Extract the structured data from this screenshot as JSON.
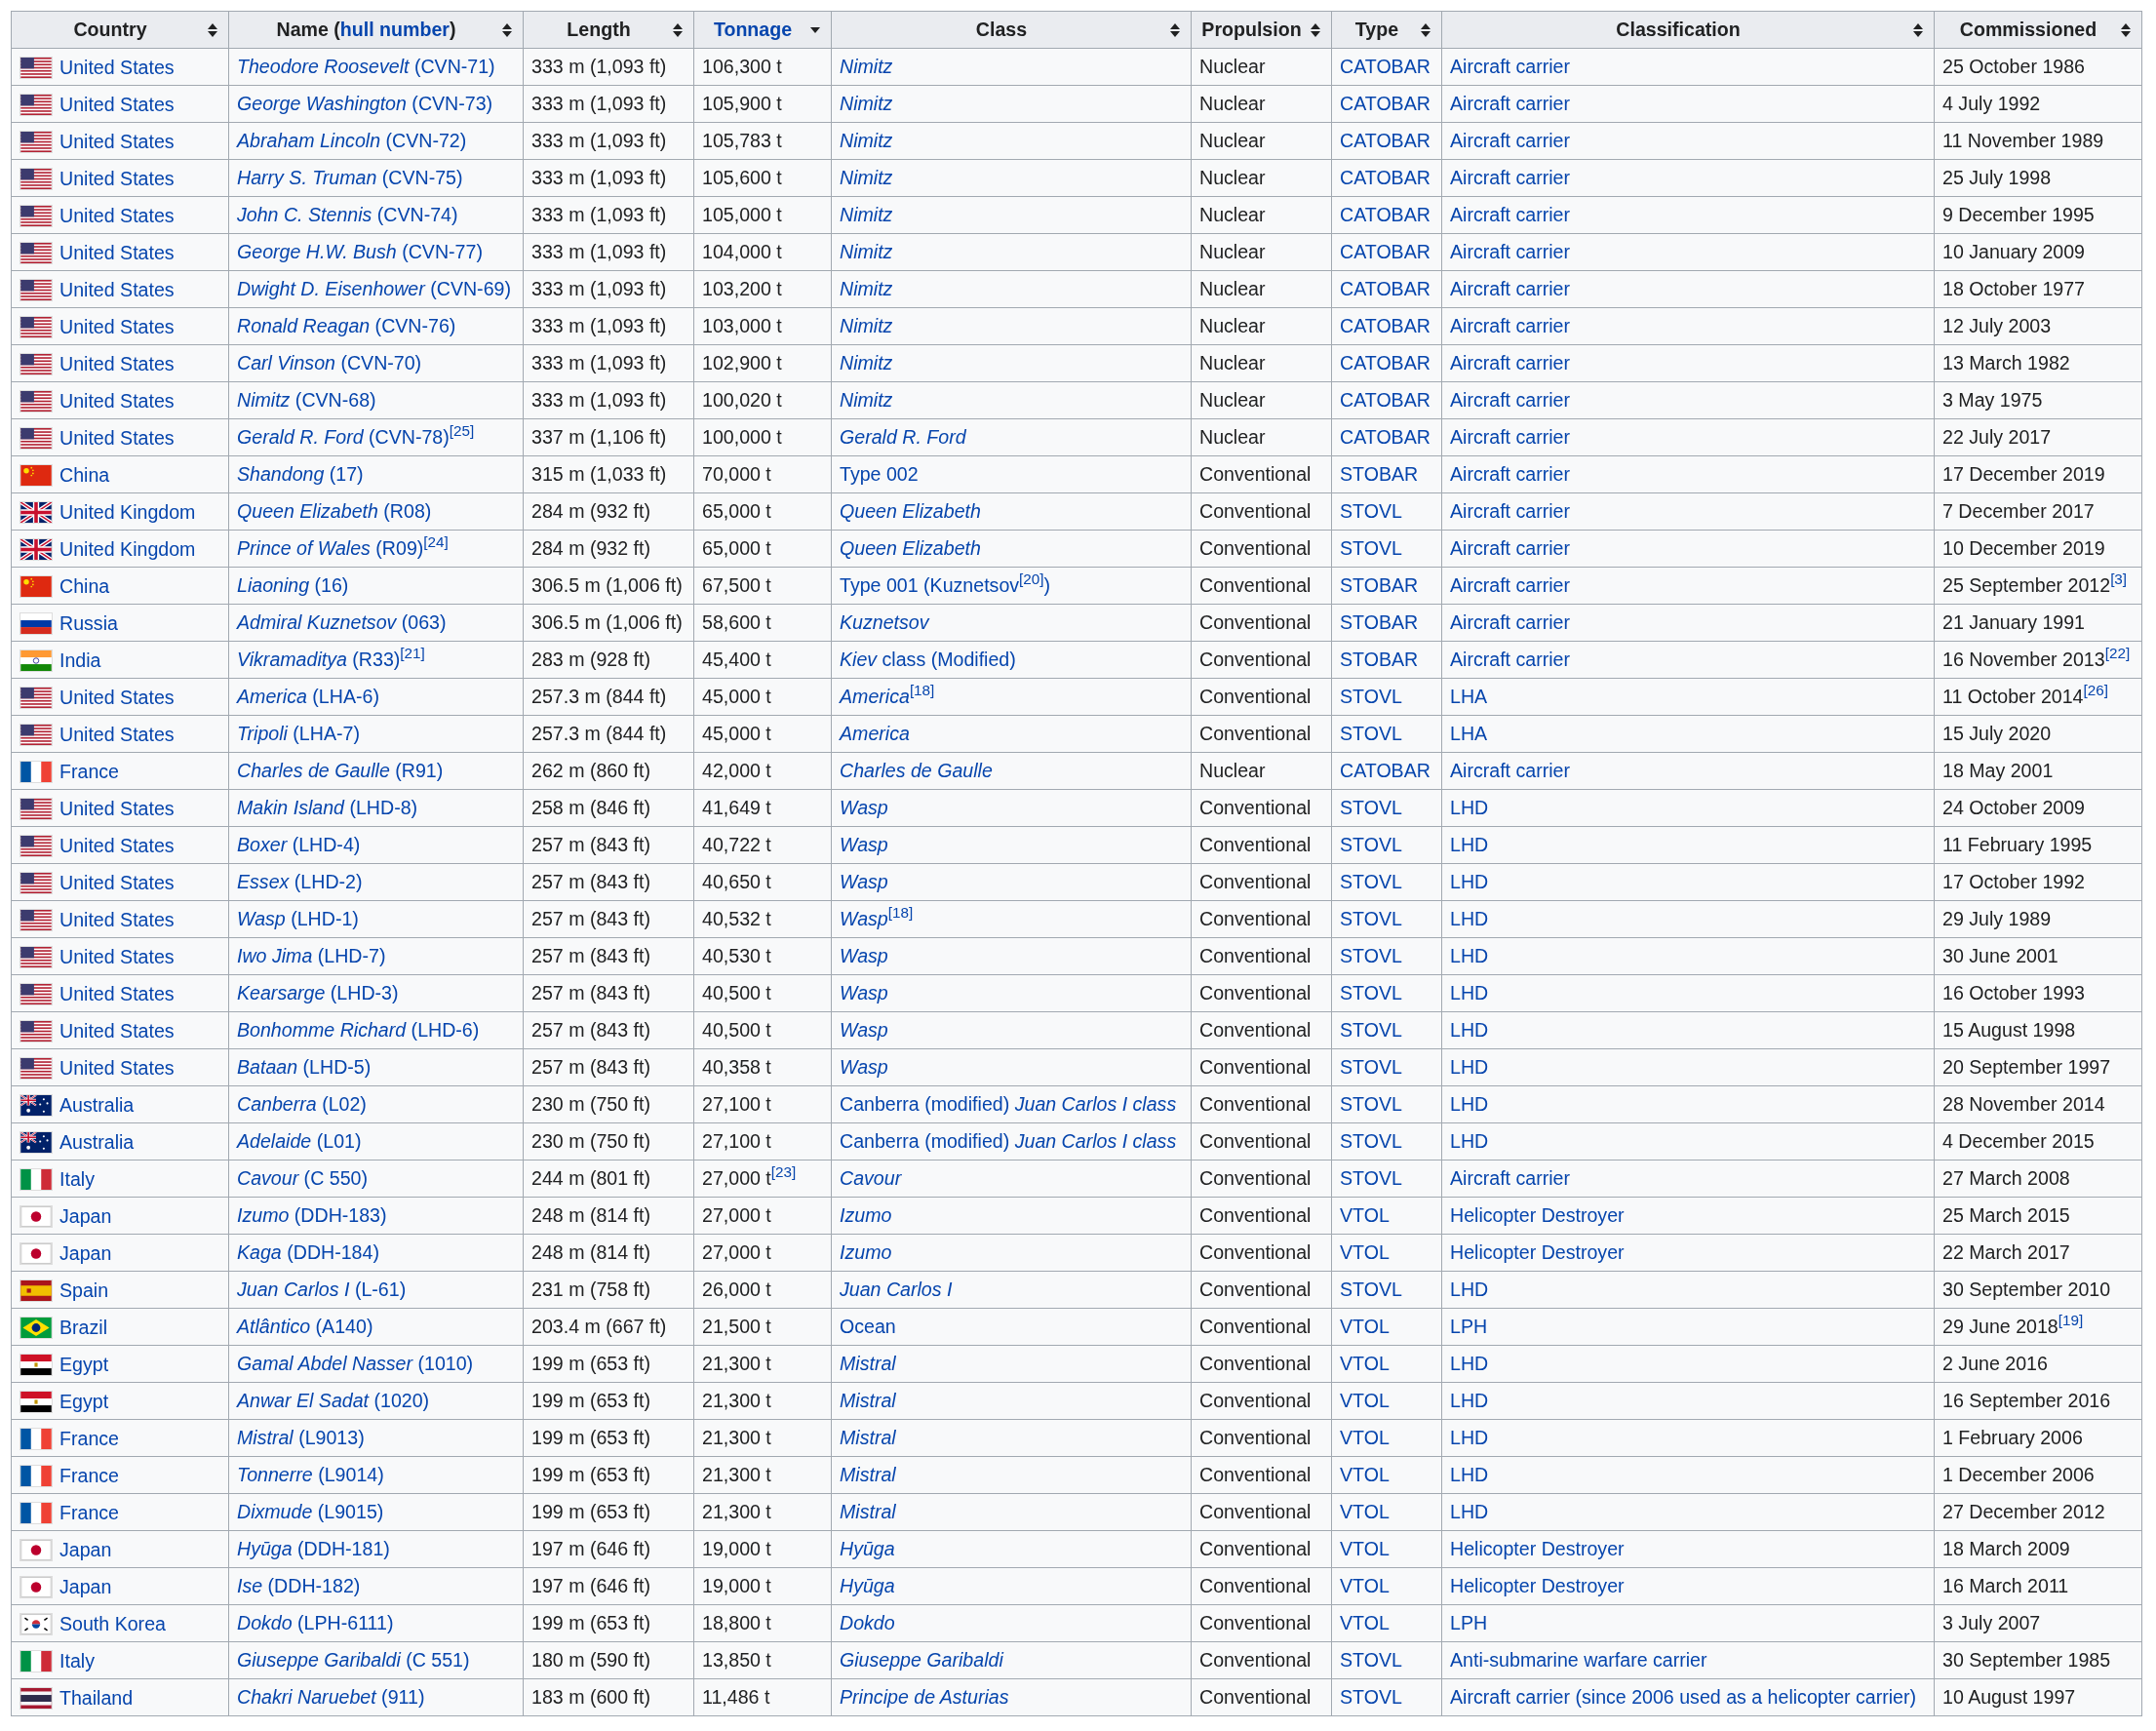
{
  "table": {
    "columns": [
      {
        "parts": [
          {
            "text": "Country",
            "link": false
          }
        ],
        "sorted": false
      },
      {
        "parts": [
          {
            "text": "Name (",
            "link": false
          },
          {
            "text": "hull number",
            "link": true
          },
          {
            "text": ")",
            "link": false
          }
        ],
        "sorted": false
      },
      {
        "parts": [
          {
            "text": "Length",
            "link": false
          }
        ],
        "sorted": false
      },
      {
        "parts": [
          {
            "text": "Tonnage",
            "link": true
          }
        ],
        "sorted": true
      },
      {
        "parts": [
          {
            "text": "Class",
            "link": false
          }
        ],
        "sorted": false
      },
      {
        "parts": [
          {
            "text": "Propulsion",
            "link": false
          }
        ],
        "sorted": false
      },
      {
        "parts": [
          {
            "text": "Type",
            "link": false
          }
        ],
        "sorted": false
      },
      {
        "parts": [
          {
            "text": "Classification",
            "link": false
          }
        ],
        "sorted": false
      },
      {
        "parts": [
          {
            "text": "Commissioned",
            "link": false
          }
        ],
        "sorted": false
      }
    ],
    "rows": [
      {
        "kind": "us",
        "country": "United States",
        "name": "*Theodore Roosevelt* (CVN-71)",
        "length": "333 m (1,093 ft)",
        "tonnage": "106,300 t",
        "class": "*Nimitz*",
        "propulsion": "Nuclear",
        "type": "CATOBAR",
        "classification": "Aircraft carrier",
        "commissioned": "25 October 1986"
      },
      {
        "kind": "us",
        "country": "United States",
        "name": "*George Washington* (CVN-73)",
        "length": "333 m (1,093 ft)",
        "tonnage": "105,900 t",
        "class": "*Nimitz*",
        "propulsion": "Nuclear",
        "type": "CATOBAR",
        "classification": "Aircraft carrier",
        "commissioned": "4 July 1992"
      },
      {
        "kind": "us",
        "country": "United States",
        "name": "*Abraham Lincoln* (CVN-72)",
        "length": "333 m (1,093 ft)",
        "tonnage": "105,783 t",
        "class": "*Nimitz*",
        "propulsion": "Nuclear",
        "type": "CATOBAR",
        "classification": "Aircraft carrier",
        "commissioned": "11 November 1989"
      },
      {
        "kind": "us",
        "country": "United States",
        "name": "*Harry S. Truman* (CVN-75)",
        "length": "333 m (1,093 ft)",
        "tonnage": "105,600 t",
        "class": "*Nimitz*",
        "propulsion": "Nuclear",
        "type": "CATOBAR",
        "classification": "Aircraft carrier",
        "commissioned": "25 July 1998"
      },
      {
        "kind": "us",
        "country": "United States",
        "name": "*John C. Stennis* (CVN-74)",
        "length": "333 m (1,093 ft)",
        "tonnage": "105,000 t",
        "class": "*Nimitz*",
        "propulsion": "Nuclear",
        "type": "CATOBAR",
        "classification": "Aircraft carrier",
        "commissioned": "9 December 1995"
      },
      {
        "kind": "us",
        "country": "United States",
        "name": "*George H.W. Bush* (CVN-77)",
        "length": "333 m (1,093 ft)",
        "tonnage": "104,000 t",
        "class": "*Nimitz*",
        "propulsion": "Nuclear",
        "type": "CATOBAR",
        "classification": "Aircraft carrier",
        "commissioned": "10 January 2009"
      },
      {
        "kind": "us",
        "country": "United States",
        "name": "*Dwight D. Eisenhower* (CVN-69)",
        "length": "333 m (1,093 ft)",
        "tonnage": "103,200 t",
        "class": "*Nimitz*",
        "propulsion": "Nuclear",
        "type": "CATOBAR",
        "classification": "Aircraft carrier",
        "commissioned": "18 October 1977"
      },
      {
        "kind": "us",
        "country": "United States",
        "name": "*Ronald Reagan* (CVN-76)",
        "length": "333 m (1,093 ft)",
        "tonnage": "103,000 t",
        "class": "*Nimitz*",
        "propulsion": "Nuclear",
        "type": "CATOBAR",
        "classification": "Aircraft carrier",
        "commissioned": "12 July 2003"
      },
      {
        "kind": "us",
        "country": "United States",
        "name": "*Carl Vinson* (CVN-70)",
        "length": "333 m (1,093 ft)",
        "tonnage": "102,900 t",
        "class": "*Nimitz*",
        "propulsion": "Nuclear",
        "type": "CATOBAR",
        "classification": "Aircraft carrier",
        "commissioned": "13 March 1982"
      },
      {
        "kind": "us",
        "country": "United States",
        "name": "*Nimitz* (CVN-68)",
        "length": "333 m (1,093 ft)",
        "tonnage": "100,020 t",
        "class": "*Nimitz*",
        "propulsion": "Nuclear",
        "type": "CATOBAR",
        "classification": "Aircraft carrier",
        "commissioned": "3 May 1975"
      },
      {
        "kind": "us",
        "country": "United States",
        "name": "*Gerald R. Ford* (CVN-78)$^{[25]}$",
        "length": "337 m (1,106 ft)",
        "tonnage": "100,000 t",
        "class": "*Gerald R. Ford*",
        "propulsion": "Nuclear",
        "type": "CATOBAR",
        "classification": "Aircraft carrier",
        "commissioned": "22 July 2017"
      },
      {
        "kind": "cn",
        "country": "China",
        "name": "*Shandong* (17)",
        "length": "315 m (1,033 ft)",
        "tonnage": "70,000 t",
        "class": "Type 002",
        "propulsion": "Conventional",
        "type": "STOBAR",
        "classification": "Aircraft carrier",
        "commissioned": "17 December 2019"
      },
      {
        "kind": "gb",
        "country": "United Kingdom",
        "name": "*Queen Elizabeth* (R08)",
        "length": "284 m (932 ft)",
        "tonnage": "65,000 t",
        "class": "*Queen Elizabeth*",
        "propulsion": "Conventional",
        "type": "STOVL",
        "classification": "Aircraft carrier",
        "commissioned": "7 December 2017"
      },
      {
        "kind": "gb",
        "country": "United Kingdom",
        "name": "*Prince of Wales* (R09)$^{[24]}$",
        "length": "284 m (932 ft)",
        "tonnage": "65,000 t",
        "class": "*Queen Elizabeth*",
        "propulsion": "Conventional",
        "type": "STOVL",
        "classification": "Aircraft carrier",
        "commissioned": "10 December 2019"
      },
      {
        "kind": "cn",
        "country": "China",
        "name": "*Liaoning* (16)",
        "length": "306.5 m (1,006 ft)",
        "tonnage": "67,500 t",
        "class": "Type 001 (Kuznetsov$^{[20]}$)",
        "propulsion": "Conventional",
        "type": "STOBAR",
        "classification": "Aircraft carrier",
        "commissioned": "25 September 2012$^{[3]}$"
      },
      {
        "kind": "ru",
        "country": "Russia",
        "name": "*Admiral Kuznetsov* (063)",
        "length": "306.5 m (1,006 ft)",
        "tonnage": "58,600 t",
        "class": "*Kuznetsov*",
        "propulsion": "Conventional",
        "type": "STOBAR",
        "classification": "Aircraft carrier",
        "commissioned": "21 January 1991"
      },
      {
        "kind": "in",
        "country": "India",
        "name": "*Vikramaditya* (R33)$^{[21]}$",
        "length": "283 m (928 ft)",
        "tonnage": "45,400 t",
        "class": "*Kiev* class (Modified)",
        "propulsion": "Conventional",
        "type": "STOBAR",
        "classification": "Aircraft carrier",
        "commissioned": "16 November 2013$^{[22]}$"
      },
      {
        "kind": "us",
        "country": "United States",
        "name": "*America* (LHA-6)",
        "length": "257.3 m (844 ft)",
        "tonnage": "45,000 t",
        "class": "*America*$^{[18]}$",
        "propulsion": "Conventional",
        "type": "STOVL",
        "classification": "LHA",
        "commissioned": "11 October 2014$^{[26]}$"
      },
      {
        "kind": "us",
        "country": "United States",
        "name": "*Tripoli* (LHA-7)",
        "length": "257.3 m (844 ft)",
        "tonnage": "45,000 t",
        "class": "*America*",
        "propulsion": "Conventional",
        "type": "STOVL",
        "classification": "LHA",
        "commissioned": "15 July 2020"
      },
      {
        "kind": "fr",
        "country": "France",
        "name": "*Charles de Gaulle* (R91)",
        "length": "262 m (860 ft)",
        "tonnage": "42,000 t",
        "class": "*Charles de Gaulle*",
        "propulsion": "Nuclear",
        "type": "CATOBAR",
        "classification": "Aircraft carrier",
        "commissioned": "18 May 2001"
      },
      {
        "kind": "us",
        "country": "United States",
        "name": "*Makin Island* (LHD-8)",
        "length": "258 m (846 ft)",
        "tonnage": "41,649 t",
        "class": "*Wasp*",
        "propulsion": "Conventional",
        "type": "STOVL",
        "classification": "LHD",
        "commissioned": "24 October 2009"
      },
      {
        "kind": "us",
        "country": "United States",
        "name": "*Boxer* (LHD-4)",
        "length": "257 m (843 ft)",
        "tonnage": "40,722 t",
        "class": "*Wasp*",
        "propulsion": "Conventional",
        "type": "STOVL",
        "classification": "LHD",
        "commissioned": "11 February 1995"
      },
      {
        "kind": "us",
        "country": "United States",
        "name": "*Essex* (LHD-2)",
        "length": "257 m (843 ft)",
        "tonnage": "40,650 t",
        "class": "*Wasp*",
        "propulsion": "Conventional",
        "type": "STOVL",
        "classification": "LHD",
        "commissioned": "17 October 1992"
      },
      {
        "kind": "us",
        "country": "United States",
        "name": "*Wasp* (LHD-1)",
        "length": "257 m (843 ft)",
        "tonnage": "40,532 t",
        "class": "*Wasp*$^{[18]}$",
        "propulsion": "Conventional",
        "type": "STOVL",
        "classification": "LHD",
        "commissioned": "29 July 1989"
      },
      {
        "kind": "us",
        "country": "United States",
        "name": "*Iwo Jima* (LHD-7)",
        "length": "257 m (843 ft)",
        "tonnage": "40,530 t",
        "class": "*Wasp*",
        "propulsion": "Conventional",
        "type": "STOVL",
        "classification": "LHD",
        "commissioned": "30 June 2001"
      },
      {
        "kind": "us",
        "country": "United States",
        "name": "*Kearsarge* (LHD-3)",
        "length": "257 m (843 ft)",
        "tonnage": "40,500 t",
        "class": "*Wasp*",
        "propulsion": "Conventional",
        "type": "STOVL",
        "classification": "LHD",
        "commissioned": "16 October 1993"
      },
      {
        "kind": "us",
        "country": "United States",
        "name": "*Bonhomme Richard* (LHD-6)",
        "length": "257 m (843 ft)",
        "tonnage": "40,500 t",
        "class": "*Wasp*",
        "propulsion": "Conventional",
        "type": "STOVL",
        "classification": "LHD",
        "commissioned": "15 August 1998"
      },
      {
        "kind": "us",
        "country": "United States",
        "name": "*Bataan* (LHD-5)",
        "length": "257 m (843 ft)",
        "tonnage": "40,358 t",
        "class": "*Wasp*",
        "propulsion": "Conventional",
        "type": "STOVL",
        "classification": "LHD",
        "commissioned": "20 September 1997"
      },
      {
        "kind": "au",
        "country": "Australia",
        "name": "*Canberra* (L02)",
        "length": "230 m (750 ft)",
        "tonnage": "27,100 t",
        "class": "Canberra (modified) *Juan Carlos I class*",
        "propulsion": "Conventional",
        "type": "STOVL",
        "classification": "LHD",
        "commissioned": "28 November 2014"
      },
      {
        "kind": "au",
        "country": "Australia",
        "name": "*Adelaide* (L01)",
        "length": "230 m (750 ft)",
        "tonnage": "27,100 t",
        "class": "Canberra (modified) *Juan Carlos I class*",
        "propulsion": "Conventional",
        "type": "STOVL",
        "classification": "LHD",
        "commissioned": "4 December 2015"
      },
      {
        "kind": "it",
        "country": "Italy",
        "name": "*Cavour* (C 550)",
        "length": "244 m (801 ft)",
        "tonnage": "27,000 t$^{[23]}$",
        "class": "*Cavour*",
        "propulsion": "Conventional",
        "type": "STOVL",
        "classification": "Aircraft carrier",
        "commissioned": "27 March 2008"
      },
      {
        "kind": "jp",
        "country": "Japan",
        "name": "*Izumo* (DDH-183)",
        "length": "248 m (814 ft)",
        "tonnage": "27,000 t",
        "class": "*Izumo*",
        "propulsion": "Conventional",
        "type": "VTOL",
        "classification": "Helicopter Destroyer",
        "commissioned": "25 March 2015"
      },
      {
        "kind": "jp",
        "country": "Japan",
        "name": "*Kaga* (DDH-184)",
        "length": "248 m (814 ft)",
        "tonnage": "27,000 t",
        "class": "*Izumo*",
        "propulsion": "Conventional",
        "type": "VTOL",
        "classification": "Helicopter Destroyer",
        "commissioned": "22 March 2017"
      },
      {
        "kind": "es",
        "country": "Spain",
        "name": "*Juan Carlos I* (L-61)",
        "length": "231 m (758 ft)",
        "tonnage": "26,000 t",
        "class": "*Juan Carlos I*",
        "propulsion": "Conventional",
        "type": "STOVL",
        "classification": "LHD",
        "commissioned": "30 September 2010"
      },
      {
        "kind": "br",
        "country": "Brazil",
        "name": "*Atlântico* (A140)",
        "length": "203.4 m (667 ft)",
        "tonnage": "21,500 t",
        "class": "Ocean",
        "propulsion": "Conventional",
        "type": "VTOL",
        "classification": "LPH",
        "commissioned": "29 June 2018$^{[19]}$"
      },
      {
        "kind": "eg",
        "country": "Egypt",
        "name": "*Gamal Abdel Nasser* (1010)",
        "length": "199 m (653 ft)",
        "tonnage": "21,300 t",
        "class": "*Mistral*",
        "propulsion": "Conventional",
        "type": "VTOL",
        "classification": "LHD",
        "commissioned": "2 June 2016"
      },
      {
        "kind": "eg",
        "country": "Egypt",
        "name": "*Anwar El Sadat* (1020)",
        "length": "199 m (653 ft)",
        "tonnage": "21,300 t",
        "class": "*Mistral*",
        "propulsion": "Conventional",
        "type": "VTOL",
        "classification": "LHD",
        "commissioned": "16 September 2016"
      },
      {
        "kind": "fr",
        "country": "France",
        "name": "*Mistral* (L9013)",
        "length": "199 m (653 ft)",
        "tonnage": "21,300 t",
        "class": "*Mistral*",
        "propulsion": "Conventional",
        "type": "VTOL",
        "classification": "LHD",
        "commissioned": "1 February 2006"
      },
      {
        "kind": "fr",
        "country": "France",
        "name": "*Tonnerre* (L9014)",
        "length": "199 m (653 ft)",
        "tonnage": "21,300 t",
        "class": "*Mistral*",
        "propulsion": "Conventional",
        "type": "VTOL",
        "classification": "LHD",
        "commissioned": "1 December 2006"
      },
      {
        "kind": "fr",
        "country": "France",
        "name": "*Dixmude* (L9015)",
        "length": "199 m (653 ft)",
        "tonnage": "21,300 t",
        "class": "*Mistral*",
        "propulsion": "Conventional",
        "type": "VTOL",
        "classification": "LHD",
        "commissioned": "27 December 2012"
      },
      {
        "kind": "jp",
        "country": "Japan",
        "name": "*Hyūga* (DDH-181)",
        "length": "197 m (646 ft)",
        "tonnage": "19,000 t",
        "class": "*Hyūga*",
        "propulsion": "Conventional",
        "type": "VTOL",
        "classification": "Helicopter Destroyer",
        "commissioned": "18 March 2009"
      },
      {
        "kind": "jp",
        "country": "Japan",
        "name": "*Ise* (DDH-182)",
        "length": "197 m (646 ft)",
        "tonnage": "19,000 t",
        "class": "*Hyūga*",
        "propulsion": "Conventional",
        "type": "VTOL",
        "classification": "Helicopter Destroyer",
        "commissioned": "16 March 2011"
      },
      {
        "kind": "kr",
        "country": "South Korea",
        "name": "*Dokdo* (LPH-6111)",
        "length": "199 m (653 ft)",
        "tonnage": "18,800 t",
        "class": "*Dokdo*",
        "propulsion": "Conventional",
        "type": "VTOL",
        "classification": "LPH",
        "commissioned": "3 July 2007"
      },
      {
        "kind": "it",
        "country": "Italy",
        "name": "*Giuseppe Garibaldi* (C 551)",
        "length": "180 m (590 ft)",
        "tonnage": "13,850 t",
        "class": "*Giuseppe Garibaldi*",
        "propulsion": "Conventional",
        "type": "STOVL",
        "classification": "Anti-submarine warfare carrier",
        "commissioned": "30 September 1985"
      },
      {
        "kind": "th",
        "country": "Thailand",
        "name": "*Chakri Naruebet* (911)",
        "length": "183 m (600 ft)",
        "tonnage": "11,486 t",
        "class": "*Principe de Asturias*",
        "propulsion": "Conventional",
        "type": "STOVL",
        "classification": "Aircraft carrier (since 2006 used as a helicopter carrier)",
        "commissioned": "10 August 1997"
      }
    ]
  }
}
